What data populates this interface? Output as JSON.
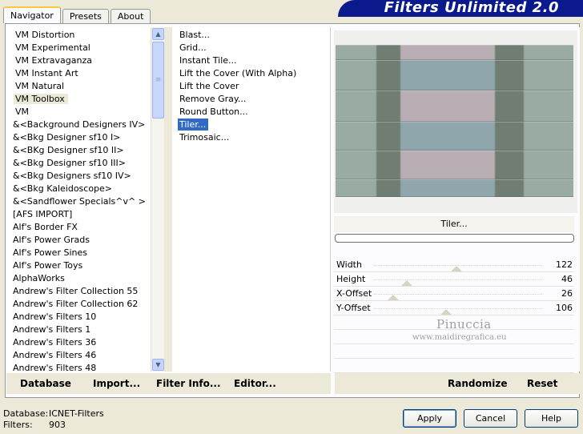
{
  "tabs": [
    {
      "label": "Navigator",
      "active": true
    },
    {
      "label": "Presets",
      "active": false
    },
    {
      "label": "About",
      "active": false
    }
  ],
  "banner_title": "Filters Unlimited 2.0",
  "categories": [
    "VM Distortion",
    "VM Experimental",
    "VM Extravaganza",
    "VM Instant Art",
    "VM Natural",
    "VM Toolbox",
    "VM",
    "&<Background Designers IV>",
    "&<Bkg Designer sf10 I>",
    "&<BKg Designer sf10 II>",
    "&<Bkg Designer sf10 III>",
    "&<Bkg Designers sf10 IV>",
    "&<Bkg Kaleidoscope>",
    "&<Sandflower Specials^v^ >",
    "[AFS IMPORT]",
    "Alf's Border FX",
    "Alf's Power Grads",
    "Alf's Power Sines",
    "Alf's Power Toys",
    "AlphaWorks",
    "Andrew's Filter Collection 55",
    "Andrew's Filter Collection 62",
    "Andrew's Filters 10",
    "Andrew's Filters 1",
    "Andrew's Filters 36",
    "Andrew's Filters 46",
    "Andrew's Filters 48"
  ],
  "selected_category": "VM Toolbox",
  "filters": [
    "Blast...",
    "Grid...",
    "Instant Tile...",
    "Lift the Cover (With Alpha)",
    "Lift the Cover",
    "Remove Gray...",
    "Round Button...",
    "Tiler...",
    "Trimosaic..."
  ],
  "selected_filter": "Tiler...",
  "preview": {
    "filter_name": "Tiler...",
    "colors": {
      "gray_green": "#9aaba3",
      "mauve": "#b8aeb4",
      "blue_gray": "#8fa6ad",
      "dark_post": "#6f7d72"
    }
  },
  "parameters": [
    {
      "name": "Width",
      "value": "122",
      "level": 0.478
    },
    {
      "name": "Height",
      "value": "46",
      "level": 0.18
    },
    {
      "name": "X-Offset",
      "value": "26",
      "level": 0.102
    },
    {
      "name": "Y-Offset",
      "value": "106",
      "level": 0.416
    }
  ],
  "watermark": {
    "name": "Pinuccia",
    "url": "www.maidiregrafica.eu"
  },
  "left_actions": {
    "database": "Database",
    "import": "Import...",
    "filter_info": "Filter Info...",
    "editor": "Editor..."
  },
  "right_actions": {
    "randomize": "Randomize",
    "reset": "Reset"
  },
  "status": {
    "database_label": "Database:",
    "database_value": "ICNET-Filters",
    "filters_label": "Filters:",
    "filters_value": "903"
  },
  "buttons": {
    "apply": "Apply",
    "cancel": "Cancel",
    "help": "Help"
  }
}
